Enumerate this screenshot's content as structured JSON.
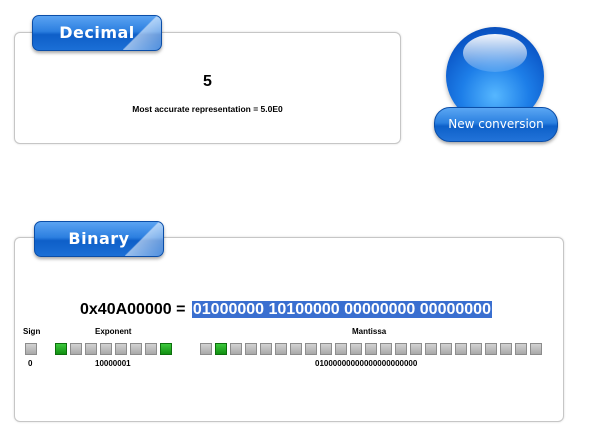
{
  "decimal": {
    "tab_label": "Decimal",
    "value": "5",
    "accuracy_text": "Most accurate representation = 5.0E0"
  },
  "new_conversion_label": "New conversion",
  "binary": {
    "tab_label": "Binary",
    "hex": "0x40A00000",
    "equals": " = ",
    "bits_text": "01000000 10100000 00000000 00000000",
    "sign_label": "Sign",
    "exponent_label": "Exponent",
    "mantissa_label": "Mantissa",
    "sign_value": "0",
    "exponent_value": "10000001",
    "mantissa_value": "01000000000000000000000",
    "sign_bits": [
      0
    ],
    "exponent_bits": [
      1,
      0,
      0,
      0,
      0,
      0,
      0,
      1
    ],
    "mantissa_bits": [
      0,
      1,
      0,
      0,
      0,
      0,
      0,
      0,
      0,
      0,
      0,
      0,
      0,
      0,
      0,
      0,
      0,
      0,
      0,
      0,
      0,
      0,
      0
    ]
  },
  "colors": {
    "accent_blue": "#1b6fd6",
    "bit_on": "#1aa31a",
    "bit_off": "#b5b5b5",
    "highlight": "#3a6fd0"
  }
}
